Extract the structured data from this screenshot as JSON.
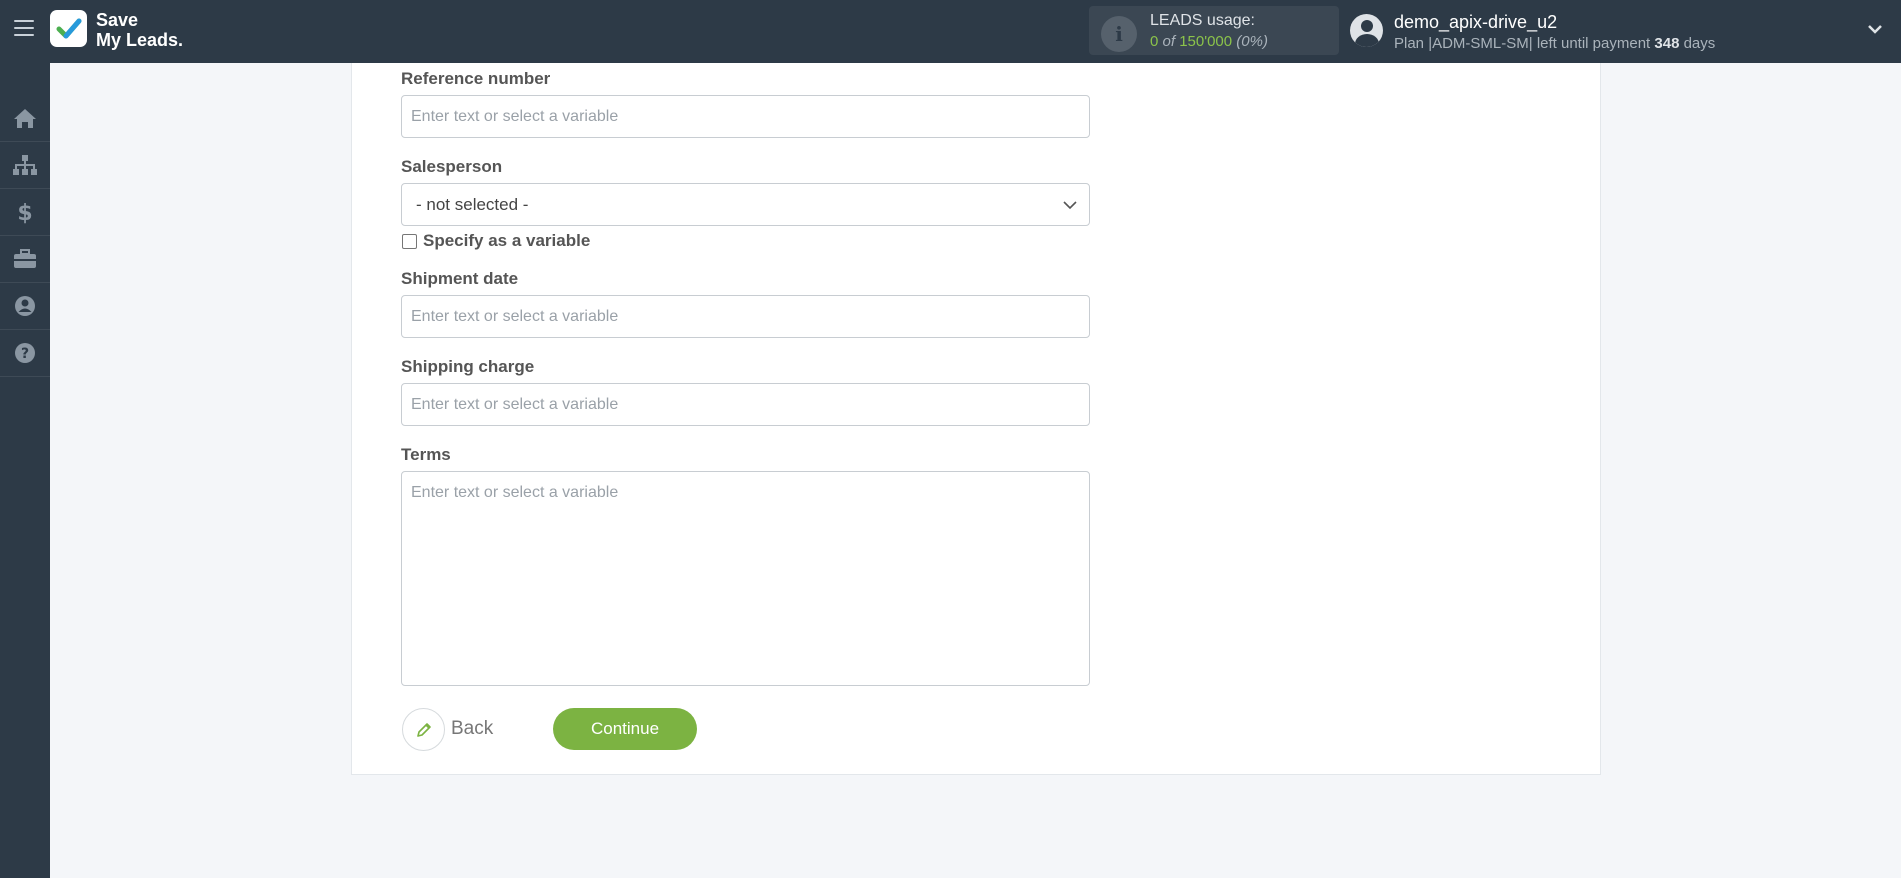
{
  "header": {
    "logo_line1": "Save",
    "logo_line2": "My Leads.",
    "usage_title": "LEADS usage:",
    "usage_used": "0",
    "usage_of": "of",
    "usage_total": "150'000",
    "usage_percent": "(0%)",
    "account_name": "demo_apix-drive_u2",
    "plan_prefix": "Plan |ADM-SML-SM| left until payment",
    "plan_days": "348",
    "plan_suffix": "days"
  },
  "sidebar": {
    "items": [
      {
        "icon": "home-icon"
      },
      {
        "icon": "sitemap-icon"
      },
      {
        "icon": "dollar-icon"
      },
      {
        "icon": "briefcase-icon"
      },
      {
        "icon": "user-icon"
      },
      {
        "icon": "help-icon"
      }
    ]
  },
  "form": {
    "reference_label": "Reference number",
    "reference_placeholder": "Enter text or select a variable",
    "salesperson_label": "Salesperson",
    "salesperson_value": "- not selected -",
    "specify_variable_label": "Specify as a variable",
    "shipment_label": "Shipment date",
    "shipment_placeholder": "Enter text or select a variable",
    "shipping_label": "Shipping charge",
    "shipping_placeholder": "Enter text or select a variable",
    "terms_label": "Terms",
    "terms_placeholder": "Enter text or select a variable"
  },
  "actions": {
    "back_label": "Back",
    "continue_label": "Continue"
  },
  "colors": {
    "header_bg": "#2d3a47",
    "accent_green": "#7cb342",
    "logo_check": "#4caf50"
  }
}
